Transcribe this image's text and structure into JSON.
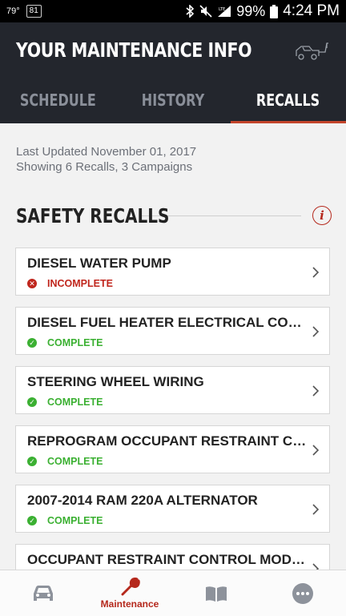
{
  "status_bar": {
    "temperature": "79°",
    "notification_badge": "81",
    "battery": "99%",
    "time": "4:24 PM"
  },
  "header": {
    "title": "YOUR MAINTENANCE INFO",
    "icon": "tow-truck-icon"
  },
  "tabs": [
    {
      "label": "SCHEDULE",
      "active": false
    },
    {
      "label": "HISTORY",
      "active": false
    },
    {
      "label": "RECALLS",
      "active": true
    }
  ],
  "info": {
    "last_updated": "Last Updated November 01, 2017",
    "summary": "Showing 6 Recalls, 3 Campaigns"
  },
  "section": {
    "title": "SAFETY RECALLS",
    "info_icon": "i"
  },
  "recalls": [
    {
      "name": "DIESEL WATER PUMP",
      "status": "INCOMPLETE",
      "state": "incomplete"
    },
    {
      "name": "DIESEL FUEL HEATER ELECTRICAL CONNE...",
      "status": "COMPLETE",
      "state": "complete"
    },
    {
      "name": "STEERING WHEEL WIRING",
      "status": "COMPLETE",
      "state": "complete"
    },
    {
      "name": "REPROGRAM OCCUPANT RESTRAINT CO...",
      "status": "COMPLETE",
      "state": "complete"
    },
    {
      "name": "2007-2014 RAM 220A ALTERNATOR",
      "status": "COMPLETE",
      "state": "complete"
    },
    {
      "name": "OCCUPANT RESTRAINT CONTROL MODULE",
      "status": "",
      "state": "complete"
    }
  ],
  "bottom_nav": {
    "items": [
      {
        "icon": "car-icon",
        "label": ""
      },
      {
        "icon": "wrench-icon",
        "label": "Maintenance"
      },
      {
        "icon": "book-icon",
        "label": ""
      },
      {
        "icon": "more-icon",
        "label": ""
      }
    ]
  },
  "colors": {
    "header_bg": "#23262d",
    "accent": "#c4452b",
    "incomplete": "#c0261d",
    "complete": "#3bb032"
  }
}
